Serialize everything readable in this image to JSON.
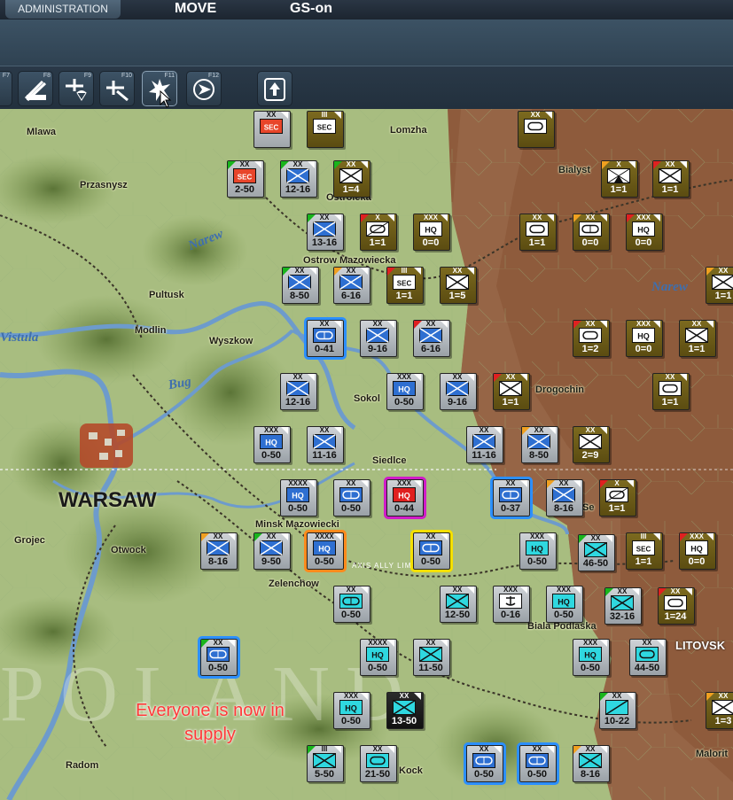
{
  "tabs": [
    {
      "label": "ADMINISTRATION",
      "active": true
    },
    {
      "label": "MOVE",
      "active": false
    },
    {
      "label": "GS-on",
      "active": false
    }
  ],
  "toolbar": [
    {
      "key": "F7",
      "icon": "partial-tool-icon"
    },
    {
      "key": "F8",
      "icon": "artillery-bombard-icon"
    },
    {
      "key": "F9",
      "icon": "paradrop-icon"
    },
    {
      "key": "F10",
      "icon": "air-strike-icon"
    },
    {
      "key": "F11",
      "icon": "explosion-icon"
    },
    {
      "key": "F12",
      "icon": "air-recon-icon"
    },
    {
      "key": "",
      "icon": "upload-arrow-icon"
    }
  ],
  "map": {
    "cities": [
      "Mlawa",
      "Lomzha",
      "Przasnysz",
      "Bialyst",
      "Ostroleka",
      "Pultusk",
      "Ostrow Mazowiecka",
      "Modlin",
      "Wyszkow",
      "Sokol",
      "Drogochin",
      "WARSAW",
      "Minsk Mazowiecki",
      "Grojec",
      "Otwock",
      "Zelenchow",
      "Biala Podlaska",
      "LITOVSK",
      "Radom",
      "Kock",
      "Malorit",
      "Siedlce",
      "Se"
    ],
    "rivers": [
      "Narew",
      "Narew",
      "Vistula",
      "Bug"
    ],
    "limit_line_label": "AXIS ALLY LIMIT LINE",
    "background_text": "POLAND",
    "message": {
      "line1": "Everyone is now in",
      "line2": "supply"
    }
  },
  "units": [
    {
      "size": "XX",
      "symbol": "SEC",
      "value": "",
      "side": "axis-red",
      "corner": ""
    },
    {
      "size": "III",
      "symbol": "SEC",
      "value": "",
      "side": "axis",
      "corner": ""
    },
    {
      "size": "XX",
      "symbol": "armor",
      "value": "",
      "side": "axis",
      "corner": ""
    },
    {
      "size": "XX",
      "symbol": "SEC",
      "value": "2-50",
      "side": "axis-red",
      "corner": "green"
    },
    {
      "size": "XX",
      "symbol": "infantry",
      "value": "12-16",
      "side": "soviet",
      "corner": "green"
    },
    {
      "size": "XX",
      "symbol": "infantry",
      "value": "1=4",
      "side": "axis",
      "corner": "green"
    },
    {
      "size": "X",
      "symbol": "mountain",
      "value": "1=1",
      "side": "axis",
      "corner": "orange"
    },
    {
      "size": "XX",
      "symbol": "infantry",
      "value": "1=1",
      "side": "axis",
      "corner": "red"
    },
    {
      "size": "XX",
      "symbol": "infantry",
      "value": "13-16",
      "side": "soviet",
      "corner": "green"
    },
    {
      "size": "X",
      "symbol": "armored-recon",
      "value": "1=1",
      "side": "axis",
      "corner": "red"
    },
    {
      "size": "XXX",
      "symbol": "HQ",
      "value": "0=0",
      "side": "axis",
      "corner": ""
    },
    {
      "size": "XX",
      "symbol": "armor",
      "value": "1=1",
      "side": "axis",
      "corner": ""
    },
    {
      "size": "XX",
      "symbol": "mech",
      "value": "0=0",
      "side": "axis",
      "corner": "orange"
    },
    {
      "size": "XXX",
      "symbol": "HQ",
      "value": "0=0",
      "side": "axis",
      "corner": "red"
    },
    {
      "size": "XX",
      "symbol": "infantry",
      "value": "8-50",
      "side": "soviet",
      "corner": "green"
    },
    {
      "size": "XX",
      "symbol": "infantry",
      "value": "6-16",
      "side": "soviet",
      "corner": "orange"
    },
    {
      "size": "III",
      "symbol": "SEC",
      "value": "1=1",
      "side": "axis",
      "corner": "red"
    },
    {
      "size": "XX",
      "symbol": "infantry",
      "value": "1=5",
      "side": "axis",
      "corner": ""
    },
    {
      "size": "XX",
      "symbol": "infantry",
      "value": "1=1",
      "side": "axis",
      "corner": "orange"
    },
    {
      "size": "XX",
      "symbol": "mech",
      "value": "0-41",
      "side": "soviet",
      "corner": "",
      "select": "blue"
    },
    {
      "size": "XX",
      "symbol": "infantry",
      "value": "9-16",
      "side": "soviet",
      "corner": ""
    },
    {
      "size": "XX",
      "symbol": "infantry",
      "value": "6-16",
      "side": "soviet",
      "corner": "red"
    },
    {
      "size": "XX",
      "symbol": "armor",
      "value": "1=2",
      "side": "axis",
      "corner": "red"
    },
    {
      "size": "XXX",
      "symbol": "HQ",
      "value": "0=0",
      "side": "axis",
      "corner": ""
    },
    {
      "size": "XX",
      "symbol": "infantry",
      "value": "1=1",
      "side": "axis",
      "corner": ""
    },
    {
      "size": "XX",
      "symbol": "infantry",
      "value": "12-16",
      "side": "soviet",
      "corner": ""
    },
    {
      "size": "XXX",
      "symbol": "HQ",
      "value": "0-50",
      "side": "soviet",
      "corner": ""
    },
    {
      "size": "XX",
      "symbol": "infantry",
      "value": "9-16",
      "side": "soviet",
      "corner": ""
    },
    {
      "size": "XX",
      "symbol": "infantry",
      "value": "1=1",
      "side": "axis",
      "corner": "red"
    },
    {
      "size": "XX",
      "symbol": "armor",
      "value": "1=1",
      "side": "axis",
      "corner": ""
    },
    {
      "size": "XXX",
      "symbol": "HQ",
      "value": "0-50",
      "side": "soviet",
      "corner": ""
    },
    {
      "size": "XX",
      "symbol": "infantry",
      "value": "11-16",
      "side": "soviet",
      "corner": ""
    },
    {
      "size": "XX",
      "symbol": "infantry",
      "value": "11-16",
      "side": "soviet",
      "corner": ""
    },
    {
      "size": "XX",
      "symbol": "infantry",
      "value": "8-50",
      "side": "soviet",
      "corner": "orange"
    },
    {
      "size": "XX",
      "symbol": "infantry",
      "value": "2=9",
      "side": "axis",
      "corner": ""
    },
    {
      "size": "XXXX",
      "symbol": "HQ",
      "value": "0-50",
      "side": "soviet",
      "corner": ""
    },
    {
      "size": "XX",
      "symbol": "mech",
      "value": "0-50",
      "side": "soviet",
      "corner": ""
    },
    {
      "size": "XXX",
      "symbol": "HQ",
      "value": "0-44",
      "side": "soviet-red",
      "corner": "",
      "select": "magenta"
    },
    {
      "size": "XX",
      "symbol": "mech",
      "value": "0-37",
      "side": "soviet",
      "corner": "",
      "select": "blue"
    },
    {
      "size": "XX",
      "symbol": "infantry",
      "value": "8-16",
      "side": "soviet",
      "corner": "orange"
    },
    {
      "size": "X",
      "symbol": "armored-recon",
      "value": "1=1",
      "side": "axis",
      "corner": "red"
    },
    {
      "size": "XX",
      "symbol": "infantry",
      "value": "8-16",
      "side": "soviet",
      "corner": "orange"
    },
    {
      "size": "XX",
      "symbol": "infantry",
      "value": "9-50",
      "side": "soviet",
      "corner": "green"
    },
    {
      "size": "XXXX",
      "symbol": "HQ",
      "value": "0-50",
      "side": "soviet",
      "corner": "",
      "select": "orange"
    },
    {
      "size": "XX",
      "symbol": "mech",
      "value": "0-50",
      "side": "soviet",
      "corner": "",
      "select": "yellow"
    },
    {
      "size": "XXX",
      "symbol": "HQ",
      "value": "0-50",
      "side": "soviet-cyan",
      "corner": ""
    },
    {
      "size": "XX",
      "symbol": "infantry",
      "value": "46-50",
      "side": "soviet-cyan",
      "corner": "green"
    },
    {
      "size": "III",
      "symbol": "SEC",
      "value": "1=1",
      "side": "axis",
      "corner": ""
    },
    {
      "size": "XXX",
      "symbol": "HQ",
      "value": "0=0",
      "side": "axis",
      "corner": "red"
    },
    {
      "size": "XX",
      "symbol": "mech",
      "value": "0-50",
      "side": "soviet-cyan",
      "corner": ""
    },
    {
      "size": "XX",
      "symbol": "infantry",
      "value": "12-50",
      "side": "soviet-cyan",
      "corner": ""
    },
    {
      "size": "XXX",
      "symbol": "anchor",
      "value": "0-16",
      "side": "soviet-white",
      "corner": ""
    },
    {
      "size": "XXX",
      "symbol": "HQ",
      "value": "0-50",
      "side": "soviet-cyan",
      "corner": ""
    },
    {
      "size": "XX",
      "symbol": "infantry",
      "value": "32-16",
      "side": "soviet-cyan",
      "corner": "green"
    },
    {
      "size": "XX",
      "symbol": "armor",
      "value": "1=24",
      "side": "axis",
      "corner": "red"
    },
    {
      "size": "XX",
      "symbol": "mech",
      "value": "0-50",
      "side": "soviet",
      "corner": "green",
      "select": "blue"
    },
    {
      "size": "XXXX",
      "symbol": "HQ",
      "value": "0-50",
      "side": "soviet-cyan",
      "corner": ""
    },
    {
      "size": "XX",
      "symbol": "infantry",
      "value": "11-50",
      "side": "soviet-cyan",
      "corner": ""
    },
    {
      "size": "XXX",
      "symbol": "HQ",
      "value": "0-50",
      "side": "soviet-cyan",
      "corner": ""
    },
    {
      "size": "XX",
      "symbol": "armor",
      "value": "44-50",
      "side": "soviet-cyan",
      "corner": ""
    },
    {
      "size": "XXX",
      "symbol": "HQ",
      "value": "0-50",
      "side": "soviet-cyan",
      "corner": ""
    },
    {
      "size": "XX",
      "symbol": "infantry",
      "value": "13-50",
      "side": "soviet-black",
      "corner": ""
    },
    {
      "size": "XX",
      "symbol": "cavalry",
      "value": "10-22",
      "side": "soviet-cyan",
      "corner": "green"
    },
    {
      "size": "XX",
      "symbol": "infantry",
      "value": "1=3",
      "side": "axis",
      "corner": "orange"
    },
    {
      "size": "III",
      "symbol": "infantry",
      "value": "5-50",
      "side": "soviet-cyan",
      "corner": "green"
    },
    {
      "size": "XX",
      "symbol": "armor",
      "value": "21-50",
      "side": "soviet-cyan",
      "corner": ""
    },
    {
      "size": "XX",
      "symbol": "mech",
      "value": "0-50",
      "side": "soviet",
      "corner": "",
      "select": "blue"
    },
    {
      "size": "XX",
      "symbol": "mech",
      "value": "0-50",
      "side": "soviet",
      "corner": "",
      "select": "blue"
    },
    {
      "size": "XX",
      "symbol": "infantry",
      "value": "8-16",
      "side": "soviet-cyan",
      "corner": "orange"
    }
  ]
}
